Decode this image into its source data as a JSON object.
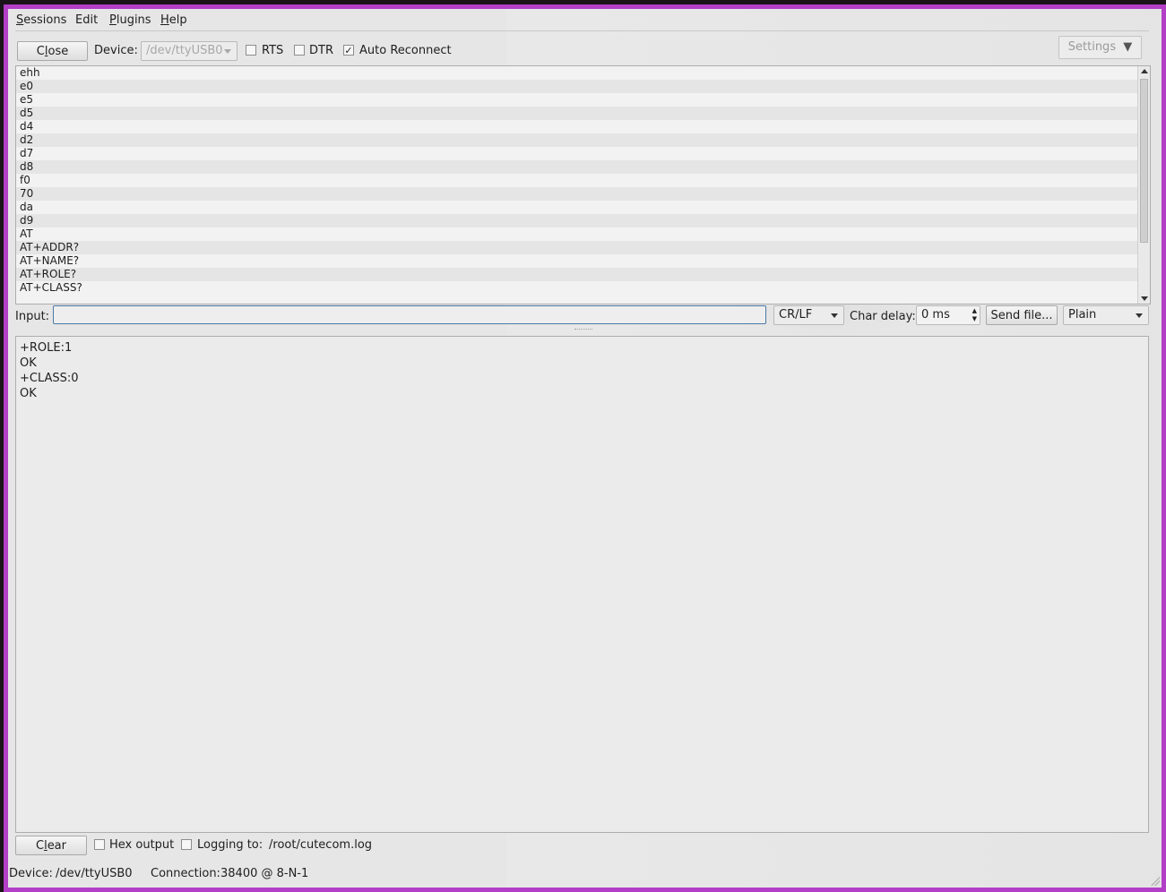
{
  "menu": {
    "sessions": "Sessions",
    "edit": "Edit",
    "plugins": "Plugins",
    "help": "Help"
  },
  "toolbar": {
    "close_label": "Close",
    "device_label": "Device:",
    "device_value": "/dev/ttyUSB0",
    "rts_label": "RTS",
    "rts_checked": false,
    "dtr_label": "DTR",
    "dtr_checked": false,
    "auto_reconnect_label": "Auto Reconnect",
    "auto_reconnect_checked": true,
    "settings_label": "Settings"
  },
  "history": [
    "ehh",
    "e0",
    "e5",
    "d5",
    "d4",
    "d2",
    "d7",
    "d8",
    "f0",
    "70",
    "da",
    "d9",
    "AT",
    "AT+ADDR?",
    "AT+NAME?",
    "AT+ROLE?",
    "AT+CLASS?"
  ],
  "input": {
    "label": "Input:",
    "value": "",
    "line_end": "CR/LF",
    "char_delay_label": "Char delay:",
    "char_delay_value": "0 ms",
    "send_file_label": "Send file...",
    "format": "Plain"
  },
  "output": [
    "+ROLE:1",
    "OK",
    "+CLASS:0",
    "OK"
  ],
  "bottom": {
    "clear_label": "Clear",
    "hex_label": "Hex output",
    "hex_checked": false,
    "logging_label": "Logging to:",
    "logging_checked": false,
    "log_path": "/root/cutecom.log"
  },
  "status": {
    "device_label": "Device:",
    "device_value": "/dev/ttyUSB0",
    "connection_label": "Connection:",
    "connection_value": "38400 @ 8-N-1"
  },
  "colors": {
    "frame": "#b23fc6",
    "window_bg": "#e6e6e6",
    "input_border": "#4a7aa8"
  }
}
